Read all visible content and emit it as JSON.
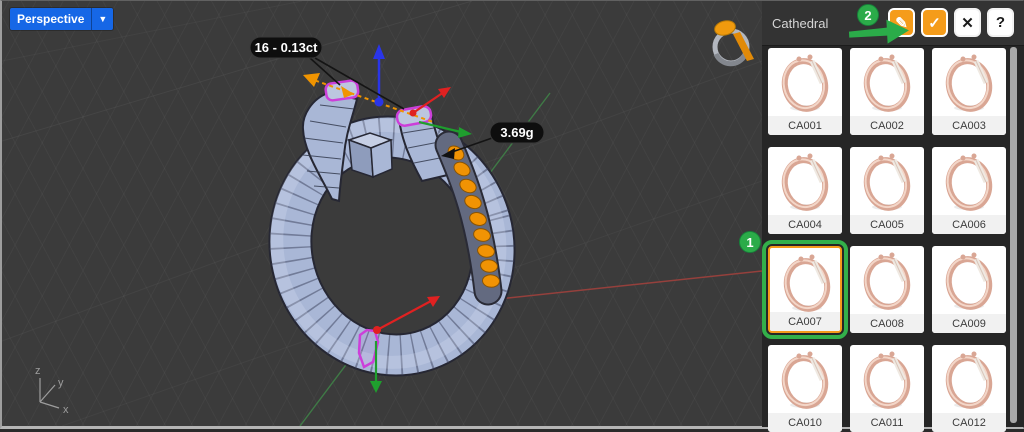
{
  "viewport": {
    "label": "Perspective",
    "dropdown_caret": "▼",
    "callouts": {
      "stones": "16 - 0.13ct",
      "weight": "3.69g"
    },
    "axes": {
      "x": "x",
      "y": "y",
      "z": "z"
    },
    "preview_icon": "ring-with-orange-gem"
  },
  "tutorial": {
    "step1": "1",
    "step2": "2"
  },
  "panel": {
    "title": "Cathedral",
    "buttons": [
      {
        "name": "edit",
        "icon": "pencil-icon",
        "glyph": "✎"
      },
      {
        "name": "confirm",
        "icon": "check-icon",
        "glyph": "✓"
      },
      {
        "name": "close",
        "icon": "close-icon",
        "glyph": "✕"
      },
      {
        "name": "help",
        "icon": "help-icon",
        "glyph": "?"
      }
    ],
    "items": [
      {
        "label": "CA001"
      },
      {
        "label": "CA002"
      },
      {
        "label": "CA003"
      },
      {
        "label": "CA004"
      },
      {
        "label": "CA005"
      },
      {
        "label": "CA006"
      },
      {
        "label": "CA007"
      },
      {
        "label": "CA008"
      },
      {
        "label": "CA009"
      },
      {
        "label": "CA010"
      },
      {
        "label": "CA011"
      },
      {
        "label": "CA012"
      }
    ],
    "selected_item": "CA007"
  },
  "colors": {
    "accent_orange": "#F59C1A",
    "annotation_green": "#2BAB49",
    "selection_magenta": "#CC3FD9",
    "gem_orange": "#F19304",
    "model_fill": "#A9B7D6",
    "viewport_label_blue": "#1667E6",
    "viewport_background": "#3B3B3B",
    "panel_background": "#262626"
  }
}
